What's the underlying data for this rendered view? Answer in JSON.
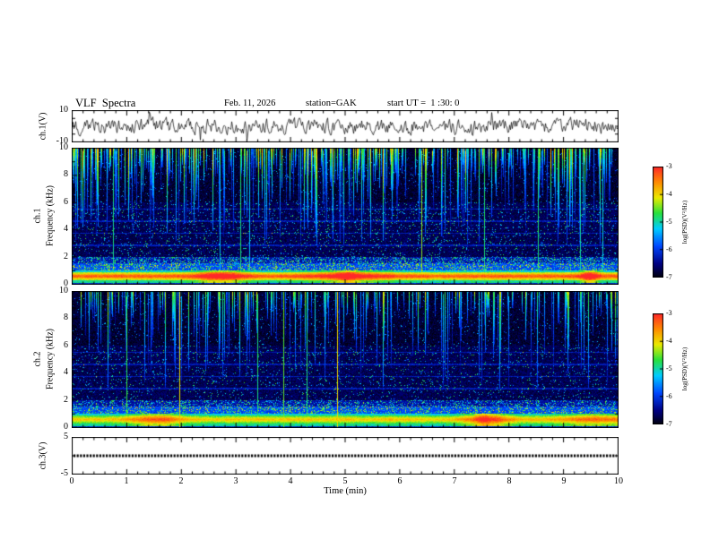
{
  "header": {
    "title": "VLF  Spectra",
    "date": "Feb. 11, 2026",
    "station": "station=GAK",
    "start_ut": "start UT =  1 :30: 0"
  },
  "xaxis": {
    "label": "Time  (min)",
    "ticks": [
      "0",
      "1",
      "2",
      "3",
      "4",
      "5",
      "6",
      "7",
      "8",
      "9",
      "10"
    ],
    "range_min": [
      0,
      10
    ]
  },
  "panels": {
    "ch1_wave": {
      "channel_label": "ch.1(V)",
      "ytick_top": "10",
      "ytick_bottom": "-10",
      "ylim": [
        -10,
        10
      ]
    },
    "ch1_spec": {
      "channel_label": "ch.1",
      "axis_label": "Frequency  (kHz)",
      "yticks": [
        "10",
        "8",
        "6",
        "4",
        "2",
        "0"
      ],
      "ylim": [
        0,
        10
      ]
    },
    "ch2_spec": {
      "channel_label": "ch.2",
      "axis_label": "Frequency  (kHz)",
      "yticks": [
        "10",
        "8",
        "6",
        "4",
        "2",
        "0"
      ],
      "ylim": [
        0,
        10
      ]
    },
    "ch3_wave": {
      "channel_label": "ch.3(V)",
      "ytick_top": "5",
      "ytick_bottom": "-5",
      "ylim": [
        -5,
        5
      ]
    }
  },
  "colorbar": {
    "label": "log(PSD)(V²/Hz)",
    "ticks": [
      "-3",
      "-4",
      "-5",
      "-6",
      "-7"
    ],
    "range": [
      -3,
      -7
    ]
  },
  "chart_data": [
    {
      "type": "line",
      "name": "ch.1 time series",
      "ylabel": "ch.1(V)",
      "xlabel": "Time (min)",
      "xlim": [
        0,
        10
      ],
      "ylim": [
        -10,
        10
      ],
      "summary": "continuous broadband noise centered on 0 V, typical excursions ±4 V with occasional spikes to ±9 V over the full 10 minutes"
    },
    {
      "type": "heatmap",
      "name": "ch.1 VLF spectrogram",
      "xlabel": "Time (min)",
      "ylabel": "Frequency (kHz)",
      "xlim": [
        0,
        10
      ],
      "ylim": [
        0,
        10
      ],
      "zlabel": "log(PSD)(V²/Hz)",
      "zlim": [
        -7,
        -3
      ],
      "features": [
        {
          "band_kHz": [
            0.3,
            1.0
          ],
          "level_logPSD": -3.8,
          "note": "intense continuous hum band, yellow-orange with red core near 0.6 kHz"
        },
        {
          "band_kHz": [
            1.0,
            2.0
          ],
          "level_logPSD": -5.5,
          "note": "bright blue-cyan speckled band"
        },
        {
          "band_kHz": [
            2.0,
            6.0
          ],
          "level_logPSD": -6.5,
          "note": "dark background with sparse blue speckle and faint horizontal striations"
        },
        {
          "band_kHz": [
            6.0,
            10.0
          ],
          "level_logPSD": -6.8,
          "note": "dark background crossed by dense green-cyan vertical sferic streaks descending from 10 kHz"
        },
        {
          "events": "a few full-height yellow-green vertical lines scattered through the record"
        }
      ]
    },
    {
      "type": "heatmap",
      "name": "ch.2 VLF spectrogram",
      "xlabel": "Time (min)",
      "ylabel": "Frequency (kHz)",
      "xlim": [
        0,
        10
      ],
      "ylim": [
        0,
        10
      ],
      "zlabel": "log(PSD)(V²/Hz)",
      "zlim": [
        -7,
        -3
      ],
      "features": [
        {
          "band_kHz": [
            0.3,
            0.9
          ],
          "level_logPSD": -4.3,
          "note": "hum band, yellow-green, weaker than ch.1"
        },
        {
          "band_kHz": [
            1.0,
            2.0
          ],
          "level_logPSD": -5.7,
          "note": "blue speckled band"
        },
        {
          "band_kHz": [
            2.0,
            6.0
          ],
          "level_logPSD": -6.6,
          "note": "dark background, sparse blue speckle"
        },
        {
          "band_kHz": [
            6.0,
            10.0
          ],
          "level_logPSD": -6.8,
          "note": "sferic streaks, sparser than ch.1"
        }
      ]
    },
    {
      "type": "line",
      "name": "ch.3 time series",
      "ylabel": "ch.3(V)",
      "xlabel": "Time (min)",
      "xlim": [
        0,
        10
      ],
      "ylim": [
        -5,
        5
      ],
      "summary": "constant flat trace at 0 V for the whole interval"
    }
  ],
  "render_params": {
    "colormap": [
      [
        0.0,
        [
          0,
          0,
          16
        ]
      ],
      [
        0.12,
        [
          0,
          0,
          130
        ]
      ],
      [
        0.28,
        [
          0,
          70,
          255
        ]
      ],
      [
        0.44,
        [
          0,
          205,
          255
        ]
      ],
      [
        0.58,
        [
          40,
          225,
          60
        ]
      ],
      [
        0.72,
        [
          235,
          235,
          0
        ]
      ],
      [
        0.86,
        [
          255,
          140,
          0
        ]
      ],
      [
        1.0,
        [
          255,
          40,
          40
        ]
      ]
    ],
    "ch1_wave": {
      "seed": 7,
      "amplitude": 0.36,
      "spike_prob": 0.02
    },
    "ch1_spec": {
      "seed": 101,
      "streak_prob": 0.5,
      "streak_gain": 3.4,
      "vline_prob": 0.012,
      "band_level": -4.4,
      "band_core": 1.15,
      "speckle_mid": 0.06,
      "speckle_low": 0.3
    },
    "ch2_spec": {
      "seed": 202,
      "streak_prob": 0.33,
      "streak_gain": 3.0,
      "vline_prob": 0.008,
      "band_level": -4.7,
      "band_core": 0.8,
      "speckle_mid": 0.05,
      "speckle_low": 0.25
    },
    "ch3_wave": {
      "seed": 9
    }
  }
}
